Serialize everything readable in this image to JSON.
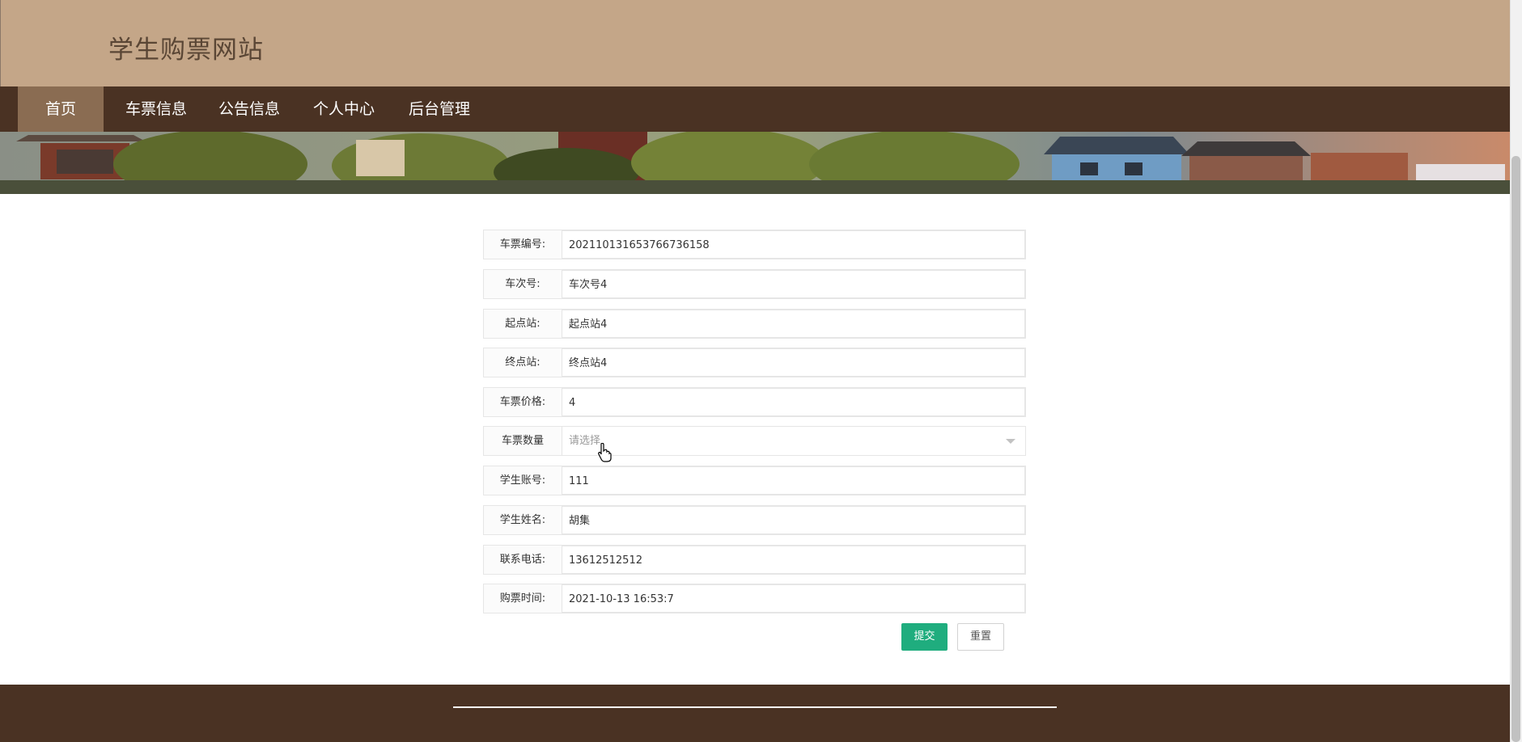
{
  "site": {
    "title": "学生购票网站"
  },
  "nav": {
    "items": [
      {
        "label": "首页",
        "active": true
      },
      {
        "label": "车票信息",
        "active": false
      },
      {
        "label": "公告信息",
        "active": false
      },
      {
        "label": "个人中心",
        "active": false
      },
      {
        "label": "后台管理",
        "active": false
      }
    ]
  },
  "form": {
    "fields": [
      {
        "label": "车票编号:",
        "value": "20211013165376673615​8"
      },
      {
        "label": "车次号:",
        "value": "车次号4"
      },
      {
        "label": "起点站:",
        "value": "起点站4"
      },
      {
        "label": "终点站:",
        "value": "终点站4"
      },
      {
        "label": "车票价格:",
        "value": "4"
      },
      {
        "label": "车票数量",
        "placeholder": "请选择"
      },
      {
        "label": "学生账号:",
        "value": "111"
      },
      {
        "label": "学生姓名:",
        "value": "胡集"
      },
      {
        "label": "联系电话:",
        "value": "13612512512"
      },
      {
        "label": "购票时间:",
        "value": "2021-10-13 16:53:7"
      }
    ],
    "submit_label": "提交",
    "reset_label": "重置"
  },
  "icons": {
    "select_caret": "chevron-down-icon",
    "cursor": "hand-pointer-icon"
  },
  "colors": {
    "header_bg": "#c4a688",
    "nav_bg": "#4a3223",
    "nav_active_bg": "#8a6c52",
    "submit_bg": "#1fad7e",
    "footer_bg": "#4a3223"
  }
}
